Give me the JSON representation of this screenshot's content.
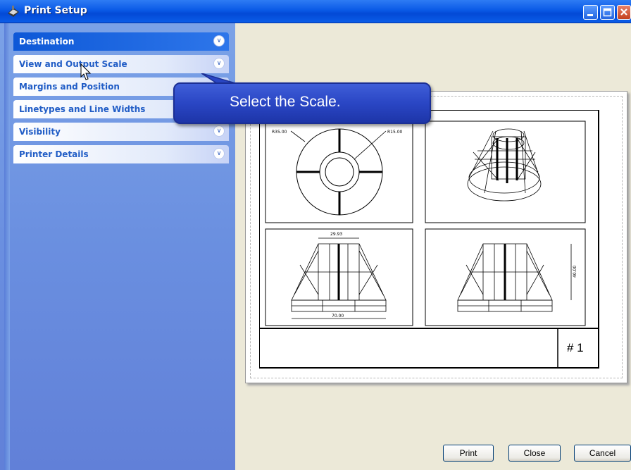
{
  "window": {
    "title": "Print Setup",
    "icon": "printer-app-icon",
    "controls": [
      "minimize",
      "maximize",
      "close"
    ]
  },
  "sidebar": {
    "sections": [
      {
        "label": "Destination",
        "active": true
      },
      {
        "label": "View and Output Scale",
        "active": false
      },
      {
        "label": "Margins and Position",
        "active": false
      },
      {
        "label": "Linetypes and Line Widths",
        "active": false
      },
      {
        "label": "Visibility",
        "active": false
      },
      {
        "label": "Printer Details",
        "active": false
      }
    ]
  },
  "tooltip": {
    "text": "Select the Scale."
  },
  "preview": {
    "dimensions": {
      "radius_outer": "R35.00",
      "radius_inner": "R15.00",
      "top_width": "29.93",
      "bottom_width": "70.00",
      "height": "40.00"
    },
    "sheet_number": "# 1"
  },
  "buttons": {
    "print": "Print",
    "close": "Close",
    "cancel": "Cancel"
  },
  "colors": {
    "titlebar": "#0A5AE6",
    "panel": "#6A8FE0",
    "active_section": "#0D58D7",
    "section_text": "#215DC6",
    "callout": "#2A46C4",
    "dialog_bg": "#ECE9D8"
  }
}
